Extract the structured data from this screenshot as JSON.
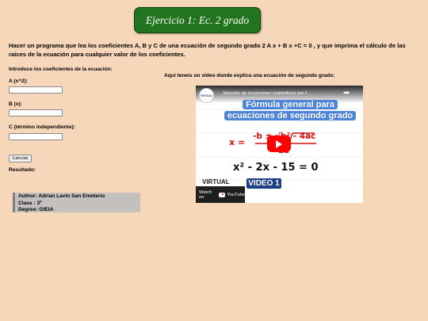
{
  "header": {
    "title": "Ejercicio 1: Ec. 2 grado"
  },
  "description": "Hacer un programa que lea los coeficientes A, B y C de una ecuación de segundo grado 2 A x + B x +C = 0 , y que imprima el cálculo de las raíces de la ecuación para cualquier valor de los coeficientes.",
  "form": {
    "intro": "Introduce los coeficientes de la ecuación:",
    "a_label": "A (x^2):",
    "b_label": "B (x):",
    "c_label": "C (término independiente):",
    "a_value": "",
    "b_value": "",
    "c_value": "",
    "button_label": "Calcular",
    "result_label": "Resultado:"
  },
  "author": {
    "name": "Author: Adrian Lavin San Emeterio",
    "class": "Class : 3º",
    "degree": "Degree: GIEIA"
  },
  "video": {
    "caption": "Aquí teneis un video donde explica una ecuación de segundo grado:",
    "title": "Solución de ecuaciones cuadráticas por f...",
    "channel_logo": "VIRTUAL",
    "banner_line1": "Fórmula general para",
    "banner_line2": "ecuaciones de segundo grado",
    "formula_lhs": "x =",
    "formula_num": "-b ± √b² - 4ac",
    "formula_den": "2a",
    "equation": "x² - 2x - 15 = 0",
    "badge": "VIDEO 1",
    "watermark": "VIRTUAL",
    "watch_on": "Watch on",
    "platform": "YouTube",
    "colors": {
      "banner": "#4f86da",
      "play": "#ff0000",
      "badge": "#1d3f87"
    },
    "icons": [
      "share-icon",
      "play-icon",
      "youtube-icon"
    ]
  }
}
